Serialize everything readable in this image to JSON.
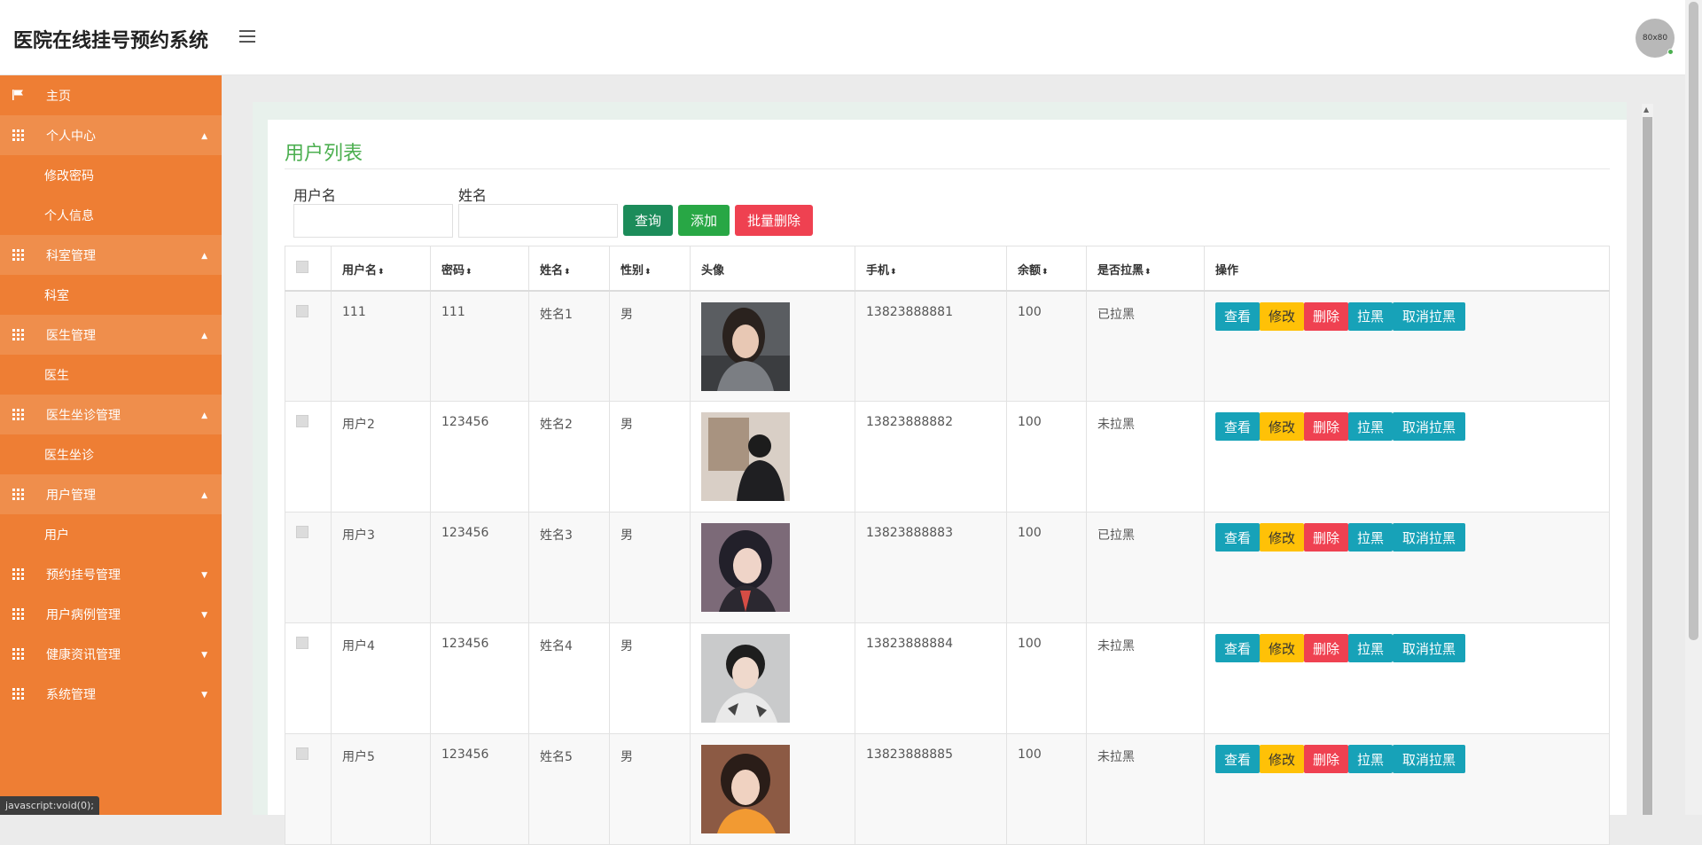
{
  "app": {
    "title": "医院在线挂号预约系统",
    "avatar_text": "80x80"
  },
  "sidebar": {
    "items": [
      {
        "label": "主页",
        "icon": "flag-icon"
      },
      {
        "label": "个人中心",
        "icon": "grid-icon"
      },
      {
        "label": "修改密码"
      },
      {
        "label": "个人信息"
      },
      {
        "label": "科室管理",
        "icon": "grid-icon"
      },
      {
        "label": "科室"
      },
      {
        "label": "医生管理",
        "icon": "grid-icon"
      },
      {
        "label": "医生"
      },
      {
        "label": "医生坐诊管理",
        "icon": "grid-icon"
      },
      {
        "label": "医生坐诊"
      },
      {
        "label": "用户管理",
        "icon": "grid-icon"
      },
      {
        "label": "用户"
      },
      {
        "label": "预约挂号管理",
        "icon": "grid-icon"
      },
      {
        "label": "用户病例管理",
        "icon": "grid-icon"
      },
      {
        "label": "健康资讯管理",
        "icon": "grid-icon"
      },
      {
        "label": "系统管理",
        "icon": "grid-icon"
      }
    ]
  },
  "status_tip": "javascript:void(0);",
  "page": {
    "title": "用户列表"
  },
  "search": {
    "username_label": "用户名",
    "name_label": "姓名",
    "username_value": "",
    "name_value": "",
    "query_btn": "查询",
    "add_btn": "添加",
    "batch_delete_btn": "批量删除"
  },
  "table": {
    "headers": [
      "用户名",
      "密码",
      "姓名",
      "性别",
      "头像",
      "手机",
      "余额",
      "是否拉黑",
      "操作"
    ],
    "actions": {
      "view": "查看",
      "edit": "修改",
      "delete": "删除",
      "blacklist": "拉黑",
      "unblacklist": "取消拉黑"
    },
    "rows": [
      {
        "username": "111",
        "password": "111",
        "name": "姓名1",
        "gender": "男",
        "phone": "13823888881",
        "balance": "100",
        "blacklisted": "已拉黑"
      },
      {
        "username": "用户2",
        "password": "123456",
        "name": "姓名2",
        "gender": "男",
        "phone": "13823888882",
        "balance": "100",
        "blacklisted": "未拉黑"
      },
      {
        "username": "用户3",
        "password": "123456",
        "name": "姓名3",
        "gender": "男",
        "phone": "13823888883",
        "balance": "100",
        "blacklisted": "已拉黑"
      },
      {
        "username": "用户4",
        "password": "123456",
        "name": "姓名4",
        "gender": "男",
        "phone": "13823888884",
        "balance": "100",
        "blacklisted": "未拉黑"
      },
      {
        "username": "用户5",
        "password": "123456",
        "name": "姓名5",
        "gender": "男",
        "phone": "13823888885",
        "balance": "100",
        "blacklisted": "未拉黑"
      }
    ]
  },
  "colors": {
    "sidebar": "#ee7e34",
    "accent_green": "#4caf50",
    "btn_info": "#17a2b8",
    "btn_warning": "#ffc107",
    "btn_danger": "#ef4151"
  }
}
